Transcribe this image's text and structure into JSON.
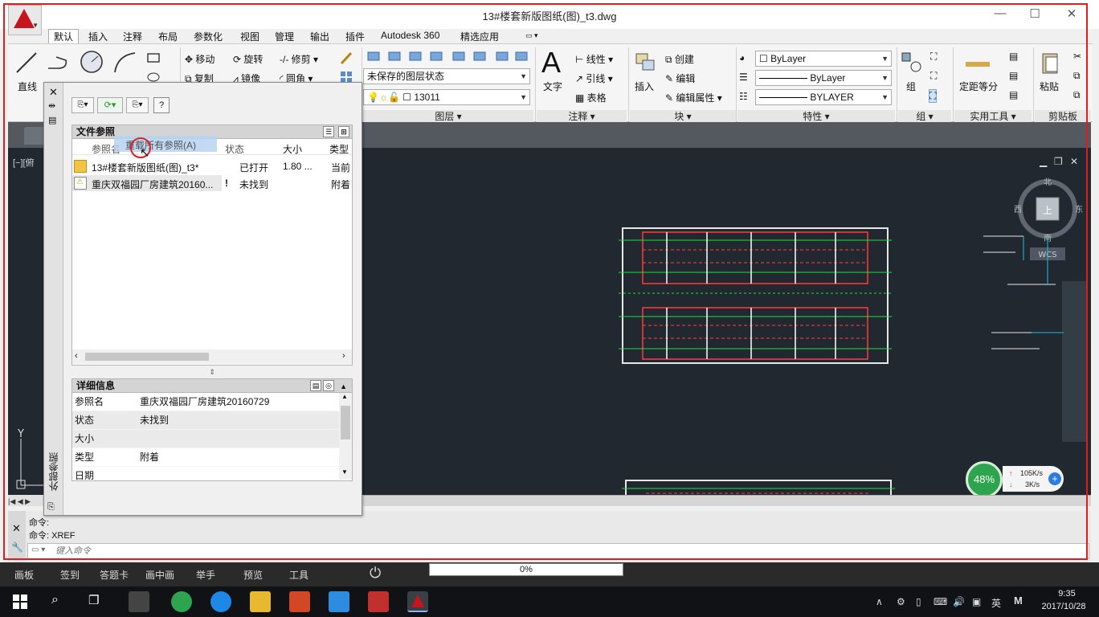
{
  "window": {
    "title": "13#楼套新版图纸(图)_t3.dwg",
    "controls": {
      "minimize": "—",
      "maximize": "☐",
      "close": "✕"
    }
  },
  "ribbon_tabs": [
    "默认",
    "插入",
    "注释",
    "布局",
    "参数化",
    "视图",
    "管理",
    "输出",
    "插件",
    "Autodesk 360",
    "精选应用"
  ],
  "ribbon": {
    "draw": {
      "line": "直线"
    },
    "modify": {
      "move": "移动",
      "rotate": "旋转",
      "trim": "修剪",
      "copy": "复制",
      "mirror": "镜像",
      "fillet": "圆角"
    },
    "layers": {
      "layer_state": "未保存的图层状态",
      "current_layer": "13011",
      "title": "图层"
    },
    "annotation": {
      "text": "文字",
      "linear": "线性",
      "leader": "引线",
      "table": "表格",
      "title": "注释"
    },
    "block": {
      "insert": "插入",
      "create": "创建",
      "edit": "编辑",
      "edit_attr": "编辑属性",
      "title": "块"
    },
    "properties": {
      "color": "ByLayer",
      "linetype": "ByLayer",
      "lineweight": "BYLAYER",
      "title": "特性"
    },
    "groups": {
      "group": "组",
      "title": "组"
    },
    "utilities": {
      "measure": "定距等分",
      "title": "实用工具"
    },
    "clipboard": {
      "paste": "粘贴",
      "title": "剪贴板"
    }
  },
  "viewport": {
    "label": "[−][俯",
    "viewcube": {
      "north": "北",
      "south": "南",
      "west": "西",
      "east": "东",
      "top": "上",
      "wcs": "WCS"
    },
    "ucs_y": "Y"
  },
  "xref_palette": {
    "side_label": "外部参照",
    "file_refs": {
      "title": "文件参照",
      "columns": [
        "参照名",
        "状态",
        "大小",
        "类型"
      ],
      "tooltip": "重载所有参照(A)",
      "rows": [
        {
          "name": "13#楼套新版图纸(图)_t3*",
          "flag": "",
          "status": "已打开",
          "size": "1.80 ...",
          "type": "当前"
        },
        {
          "name": "重庆双福园厂房建筑20160...",
          "flag": "!",
          "status": "未找到",
          "size": "",
          "type": "附着"
        }
      ]
    },
    "details": {
      "title": "详细信息",
      "rows": [
        {
          "key": "参照名",
          "value": "重庆双福园厂房建筑20160729"
        },
        {
          "key": "状态",
          "value": "未找到"
        },
        {
          "key": "大小",
          "value": ""
        },
        {
          "key": "类型",
          "value": "附着"
        },
        {
          "key": "日期",
          "value": ""
        }
      ]
    }
  },
  "command": {
    "history": [
      "命令:",
      "命令:  XREF"
    ],
    "placeholder": "键入命令"
  },
  "net_widget": {
    "percent": "48%",
    "up": "105K/s",
    "down": "3K/s"
  },
  "recorder_bar": {
    "items": [
      "画板",
      "签到",
      "答题卡",
      "画中画",
      "举手",
      "预览",
      "工具"
    ],
    "progress_label": "0%",
    "progress": 0
  },
  "taskbar": {
    "time": "9:35",
    "date": "2017/10/28",
    "ime": "英",
    "ime_mode": "M"
  }
}
